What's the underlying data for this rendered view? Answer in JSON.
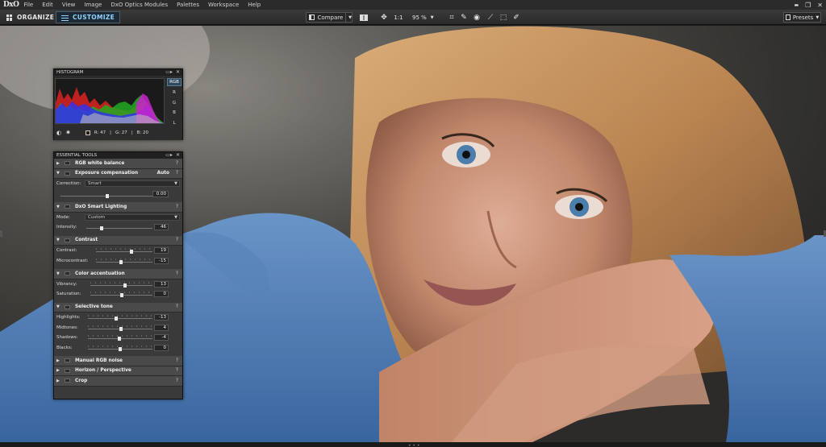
{
  "app": {
    "logo": "DxO"
  },
  "menu": [
    "File",
    "Edit",
    "View",
    "Image",
    "DxO Optics Modules",
    "Palettes",
    "Workspace",
    "Help"
  ],
  "window_controls": {
    "minimize": "▬",
    "restore": "❐",
    "close": "✕"
  },
  "tabs": {
    "organize": "ORGANIZE",
    "customize": "CUSTOMIZE"
  },
  "toolbar": {
    "compare": "Compare",
    "one_to_one": "1:1",
    "zoom": "95 %",
    "presets": "Presets"
  },
  "histogram": {
    "title": "HISTOGRAM",
    "channels": [
      "RGB",
      "R",
      "G",
      "B",
      "L"
    ],
    "active_channel": "RGB",
    "readout_r": "R:  47",
    "readout_g": "G:  27",
    "readout_b": "B:  20",
    "sep": "|"
  },
  "essential_tools": {
    "title": "ESSENTIAL TOOLS",
    "sections": {
      "white_balance": "RGB white balance",
      "exposure": "Exposure compensation",
      "exposure_auto": "Auto",
      "smart_lighting": "DxO Smart Lighting",
      "contrast": "Contrast",
      "color": "Color accentuation",
      "selective": "Selective tone",
      "rgb_noise": "Manual RGB noise",
      "horizon": "Horizon / Perspective",
      "crop": "Crop"
    },
    "exposure_correction_label": "Correction:",
    "exposure_correction_value": "Smart",
    "exposure_value": "0.00",
    "mode_label": "Mode:",
    "mode_value": "Custom",
    "intensity_label": "Intensity:",
    "intensity_value": "46",
    "contrast_label": "Contrast:",
    "contrast_value": "19",
    "microcontrast_label": "Microcontrast:",
    "microcontrast_value": "-15",
    "vibrancy_label": "Vibrancy:",
    "vibrancy_value": "13",
    "saturation_label": "Saturation:",
    "saturation_value": "0",
    "highlights_label": "Highlights:",
    "highlights_value": "-13",
    "midtones_label": "Midtones:",
    "midtones_value": "4",
    "shadows_label": "Shadows:",
    "shadows_value": "-4",
    "blacks_label": "Blacks:",
    "blacks_value": "0",
    "help": "?"
  },
  "colors": {
    "accent": "#8fd3ff",
    "panel": "#3a3a3a",
    "header": "#202020"
  }
}
